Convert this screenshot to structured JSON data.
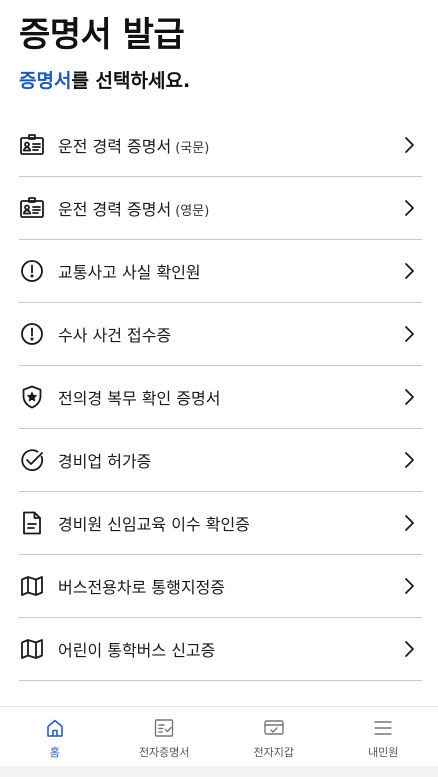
{
  "header": {
    "title": "증명서 발급",
    "subtitle_accent": "증명서",
    "subtitle_rest": "를 선택하세요."
  },
  "list": {
    "items": [
      {
        "label": "운전 경력 증명서",
        "sub": "(국문)",
        "icon": "id-card-icon"
      },
      {
        "label": "운전 경력 증명서",
        "sub": "(영문)",
        "icon": "id-card-icon"
      },
      {
        "label": "교통사고 사실 확인원",
        "sub": "",
        "icon": "alert-circle-icon"
      },
      {
        "label": "수사 사건 접수증",
        "sub": "",
        "icon": "alert-circle-icon"
      },
      {
        "label": "전의경 복무 확인 증명서",
        "sub": "",
        "icon": "shield-star-icon"
      },
      {
        "label": "경비업 허가증",
        "sub": "",
        "icon": "check-circle-icon"
      },
      {
        "label": "경비원 신임교육 이수 확인증",
        "sub": "",
        "icon": "document-icon"
      },
      {
        "label": "버스전용차로 통행지정증",
        "sub": "",
        "icon": "map-icon"
      },
      {
        "label": "어린이 통학버스 신고증",
        "sub": "",
        "icon": "map-icon"
      }
    ]
  },
  "nav": {
    "items": [
      {
        "label": "홈",
        "icon": "home-icon",
        "active": true
      },
      {
        "label": "전자증명서",
        "icon": "certificate-icon",
        "active": false
      },
      {
        "label": "전자지갑",
        "icon": "wallet-icon",
        "active": false
      },
      {
        "label": "내민원",
        "icon": "menu-icon",
        "active": false
      }
    ]
  },
  "colors": {
    "accent": "#1e5ab6",
    "text": "#1a1a1a",
    "divider": "#c9c9c9"
  }
}
